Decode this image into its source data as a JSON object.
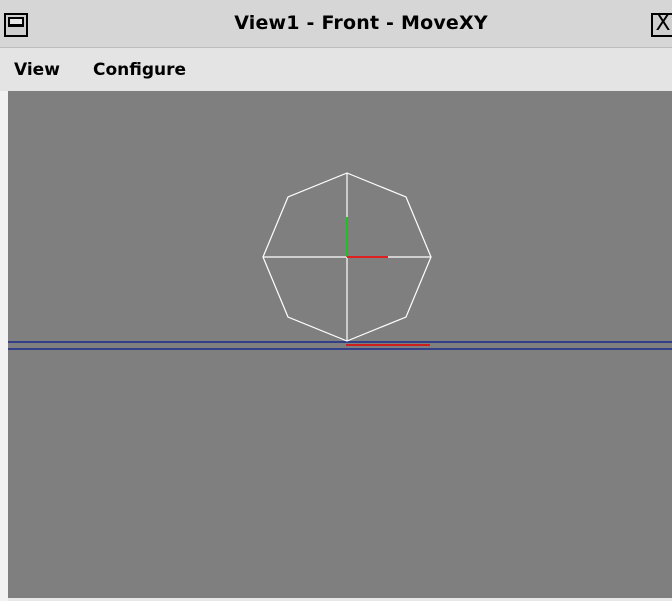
{
  "window": {
    "title": "View1 - Front - MoveXY"
  },
  "titlebar": {
    "left_button_icon": "window-menu-icon",
    "close_button_icon": "close-icon",
    "close_glyph": "X"
  },
  "menubar": {
    "items": [
      {
        "label": "View"
      },
      {
        "label": "Configure"
      }
    ]
  },
  "viewport": {
    "background": "#7f7f7f",
    "object": "octagon-wireframe",
    "colors": {
      "wireframe": "#ffffff",
      "x_axis": "#e02020",
      "y_axis": "#20c020",
      "ground_line": "#1a2a8a",
      "ground_marker": "#cc2020"
    }
  }
}
